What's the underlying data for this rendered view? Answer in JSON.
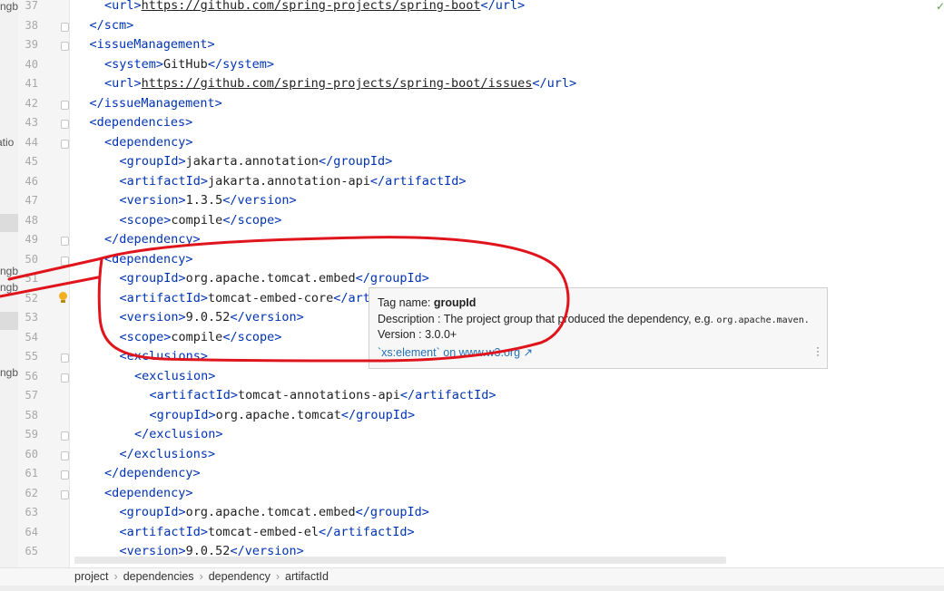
{
  "sidebar_fragments": [
    "ngb",
    "atio",
    "ngb",
    "ngb",
    "ngb"
  ],
  "gutter": {
    "line_numbers": [
      "37",
      "38",
      "39",
      "40",
      "41",
      "42",
      "43",
      "44",
      "45",
      "46",
      "47",
      "48",
      "49",
      "50",
      "51",
      "52",
      "53",
      "54",
      "55",
      "56",
      "57",
      "58",
      "59",
      "60",
      "61",
      "62",
      "63",
      "64",
      "65"
    ]
  },
  "code_lines": [
    {
      "indent": 2,
      "segments": [
        {
          "t": "<url>",
          "c": "tag"
        },
        {
          "t": "https://github.com/spring-projects/spring-boot",
          "c": "link"
        },
        {
          "t": "</url>",
          "c": "tag"
        }
      ]
    },
    {
      "indent": 1,
      "segments": [
        {
          "t": "</scm>",
          "c": "tag"
        }
      ]
    },
    {
      "indent": 1,
      "segments": [
        {
          "t": "<issueManagement>",
          "c": "tag"
        }
      ]
    },
    {
      "indent": 2,
      "segments": [
        {
          "t": "<system>",
          "c": "tag"
        },
        {
          "t": "GitHub",
          "c": "val"
        },
        {
          "t": "</system>",
          "c": "tag"
        }
      ]
    },
    {
      "indent": 2,
      "segments": [
        {
          "t": "<url>",
          "c": "tag"
        },
        {
          "t": "https://github.com/spring-projects/spring-boot/issues",
          "c": "link"
        },
        {
          "t": "</url>",
          "c": "tag"
        }
      ]
    },
    {
      "indent": 1,
      "segments": [
        {
          "t": "</issueManagement>",
          "c": "tag"
        }
      ]
    },
    {
      "indent": 1,
      "segments": [
        {
          "t": "<dependencies>",
          "c": "tag"
        }
      ]
    },
    {
      "indent": 2,
      "segments": [
        {
          "t": "<dependency>",
          "c": "tag"
        }
      ]
    },
    {
      "indent": 3,
      "segments": [
        {
          "t": "<groupId>",
          "c": "tag"
        },
        {
          "t": "jakarta.annotation",
          "c": "val"
        },
        {
          "t": "</groupId>",
          "c": "tag"
        }
      ]
    },
    {
      "indent": 3,
      "segments": [
        {
          "t": "<artifactId>",
          "c": "tag"
        },
        {
          "t": "jakarta.annotation-api",
          "c": "val"
        },
        {
          "t": "</artifactId>",
          "c": "tag"
        }
      ]
    },
    {
      "indent": 3,
      "segments": [
        {
          "t": "<version>",
          "c": "tag"
        },
        {
          "t": "1.3.5",
          "c": "val"
        },
        {
          "t": "</version>",
          "c": "tag"
        }
      ]
    },
    {
      "indent": 3,
      "segments": [
        {
          "t": "<scope>",
          "c": "tag"
        },
        {
          "t": "compile",
          "c": "val"
        },
        {
          "t": "</scope>",
          "c": "tag"
        }
      ]
    },
    {
      "indent": 2,
      "segments": [
        {
          "t": "</dependency>",
          "c": "tag"
        }
      ]
    },
    {
      "indent": 2,
      "segments": [
        {
          "t": "<dependency>",
          "c": "tag"
        }
      ]
    },
    {
      "indent": 3,
      "segments": [
        {
          "t": "<groupId>",
          "c": "tag"
        },
        {
          "t": "org.apache.tomcat.embed",
          "c": "val"
        },
        {
          "t": "</groupId>",
          "c": "tag"
        }
      ]
    },
    {
      "indent": 3,
      "segments": [
        {
          "t": "<artifactId>",
          "c": "tag"
        },
        {
          "t": "tomcat-embed-core",
          "c": "val"
        },
        {
          "t": "</art",
          "c": "tag"
        }
      ]
    },
    {
      "indent": 3,
      "segments": [
        {
          "t": "<version>",
          "c": "tag"
        },
        {
          "t": "9.0.52",
          "c": "val"
        },
        {
          "t": "</version>",
          "c": "tag"
        }
      ]
    },
    {
      "indent": 3,
      "segments": [
        {
          "t": "<scope>",
          "c": "tag"
        },
        {
          "t": "compile",
          "c": "val"
        },
        {
          "t": "</scope>",
          "c": "tag"
        }
      ]
    },
    {
      "indent": 3,
      "segments": [
        {
          "t": "<exclusions>",
          "c": "tag"
        }
      ]
    },
    {
      "indent": 4,
      "segments": [
        {
          "t": "<exclusion>",
          "c": "tag"
        }
      ]
    },
    {
      "indent": 5,
      "segments": [
        {
          "t": "<artifactId>",
          "c": "tag"
        },
        {
          "t": "tomcat-annotations-api",
          "c": "val"
        },
        {
          "t": "</artifactId>",
          "c": "tag"
        }
      ]
    },
    {
      "indent": 5,
      "segments": [
        {
          "t": "<groupId>",
          "c": "tag"
        },
        {
          "t": "org.apache.tomcat",
          "c": "val"
        },
        {
          "t": "</groupId>",
          "c": "tag"
        }
      ]
    },
    {
      "indent": 4,
      "segments": [
        {
          "t": "</exclusion>",
          "c": "tag"
        }
      ]
    },
    {
      "indent": 3,
      "segments": [
        {
          "t": "</exclusions>",
          "c": "tag"
        }
      ]
    },
    {
      "indent": 2,
      "segments": [
        {
          "t": "</dependency>",
          "c": "tag"
        }
      ]
    },
    {
      "indent": 2,
      "segments": [
        {
          "t": "<dependency>",
          "c": "tag"
        }
      ]
    },
    {
      "indent": 3,
      "segments": [
        {
          "t": "<groupId>",
          "c": "tag"
        },
        {
          "t": "org.apache.tomcat.embed",
          "c": "val"
        },
        {
          "t": "</groupId>",
          "c": "tag"
        }
      ]
    },
    {
      "indent": 3,
      "segments": [
        {
          "t": "<artifactId>",
          "c": "tag"
        },
        {
          "t": "tomcat-embed-el",
          "c": "val"
        },
        {
          "t": "</artifactId>",
          "c": "tag"
        }
      ]
    },
    {
      "indent": 3,
      "segments": [
        {
          "t": "<version>",
          "c": "tag"
        },
        {
          "t": "9.0.52",
          "c": "val"
        },
        {
          "t": "</version>",
          "c": "tag"
        }
      ]
    }
  ],
  "tooltip": {
    "tag_label": "Tag name: ",
    "tag_name": "groupId",
    "description_label": "Description : The project group that produced the dependency, e.g. ",
    "description_example": "org.apache.maven.",
    "version": "Version : 3.0.0+",
    "source_element": "`xs:element`",
    "source_on": " on ",
    "source_site": "www.w3.org",
    "source_arrow": " ↗",
    "more_icon": "more-vertical-icon"
  },
  "breadcrumb": [
    "project",
    "dependencies",
    "dependency",
    "artifactId"
  ],
  "colors": {
    "tag": "#0033b3",
    "value": "#222222",
    "annotation_red": "#e0141c",
    "link": "#2470b3",
    "bulb": "#f2b01e"
  },
  "icons": {
    "status": "check-icon",
    "intention": "lightbulb-icon"
  }
}
